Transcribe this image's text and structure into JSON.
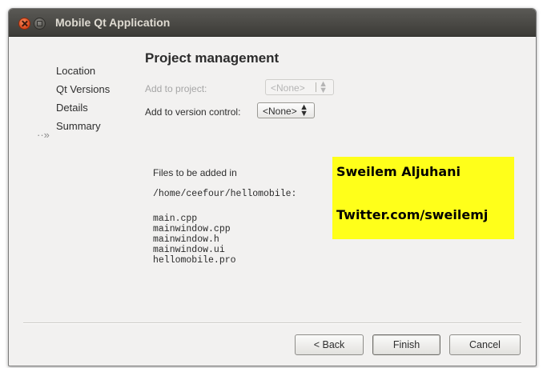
{
  "window": {
    "title": "Mobile Qt Application"
  },
  "sidebar": {
    "items": [
      {
        "label": "Location"
      },
      {
        "label": "Qt Versions"
      },
      {
        "label": "Details"
      },
      {
        "label": "Summary"
      }
    ],
    "current_marker": "··»"
  },
  "page": {
    "title": "Project management",
    "add_to_project": {
      "label": "Add to project:",
      "value": "<None>",
      "enabled": false
    },
    "add_to_vcs": {
      "label": "Add to version control:",
      "value": "<None>",
      "enabled": true
    },
    "files_heading": "Files to be added in",
    "directory": "/home/ceefour/hellomobile:",
    "files": [
      "main.cpp",
      "mainwindow.cpp",
      "mainwindow.h",
      "mainwindow.ui",
      "hellomobile.pro"
    ]
  },
  "overlay": {
    "line1": "Sweilem Aljuhani",
    "line2": "Twitter.com/sweilemj",
    "color": "#ffff1a"
  },
  "buttons": {
    "back": "< Back",
    "finish": "Finish",
    "cancel": "Cancel"
  }
}
